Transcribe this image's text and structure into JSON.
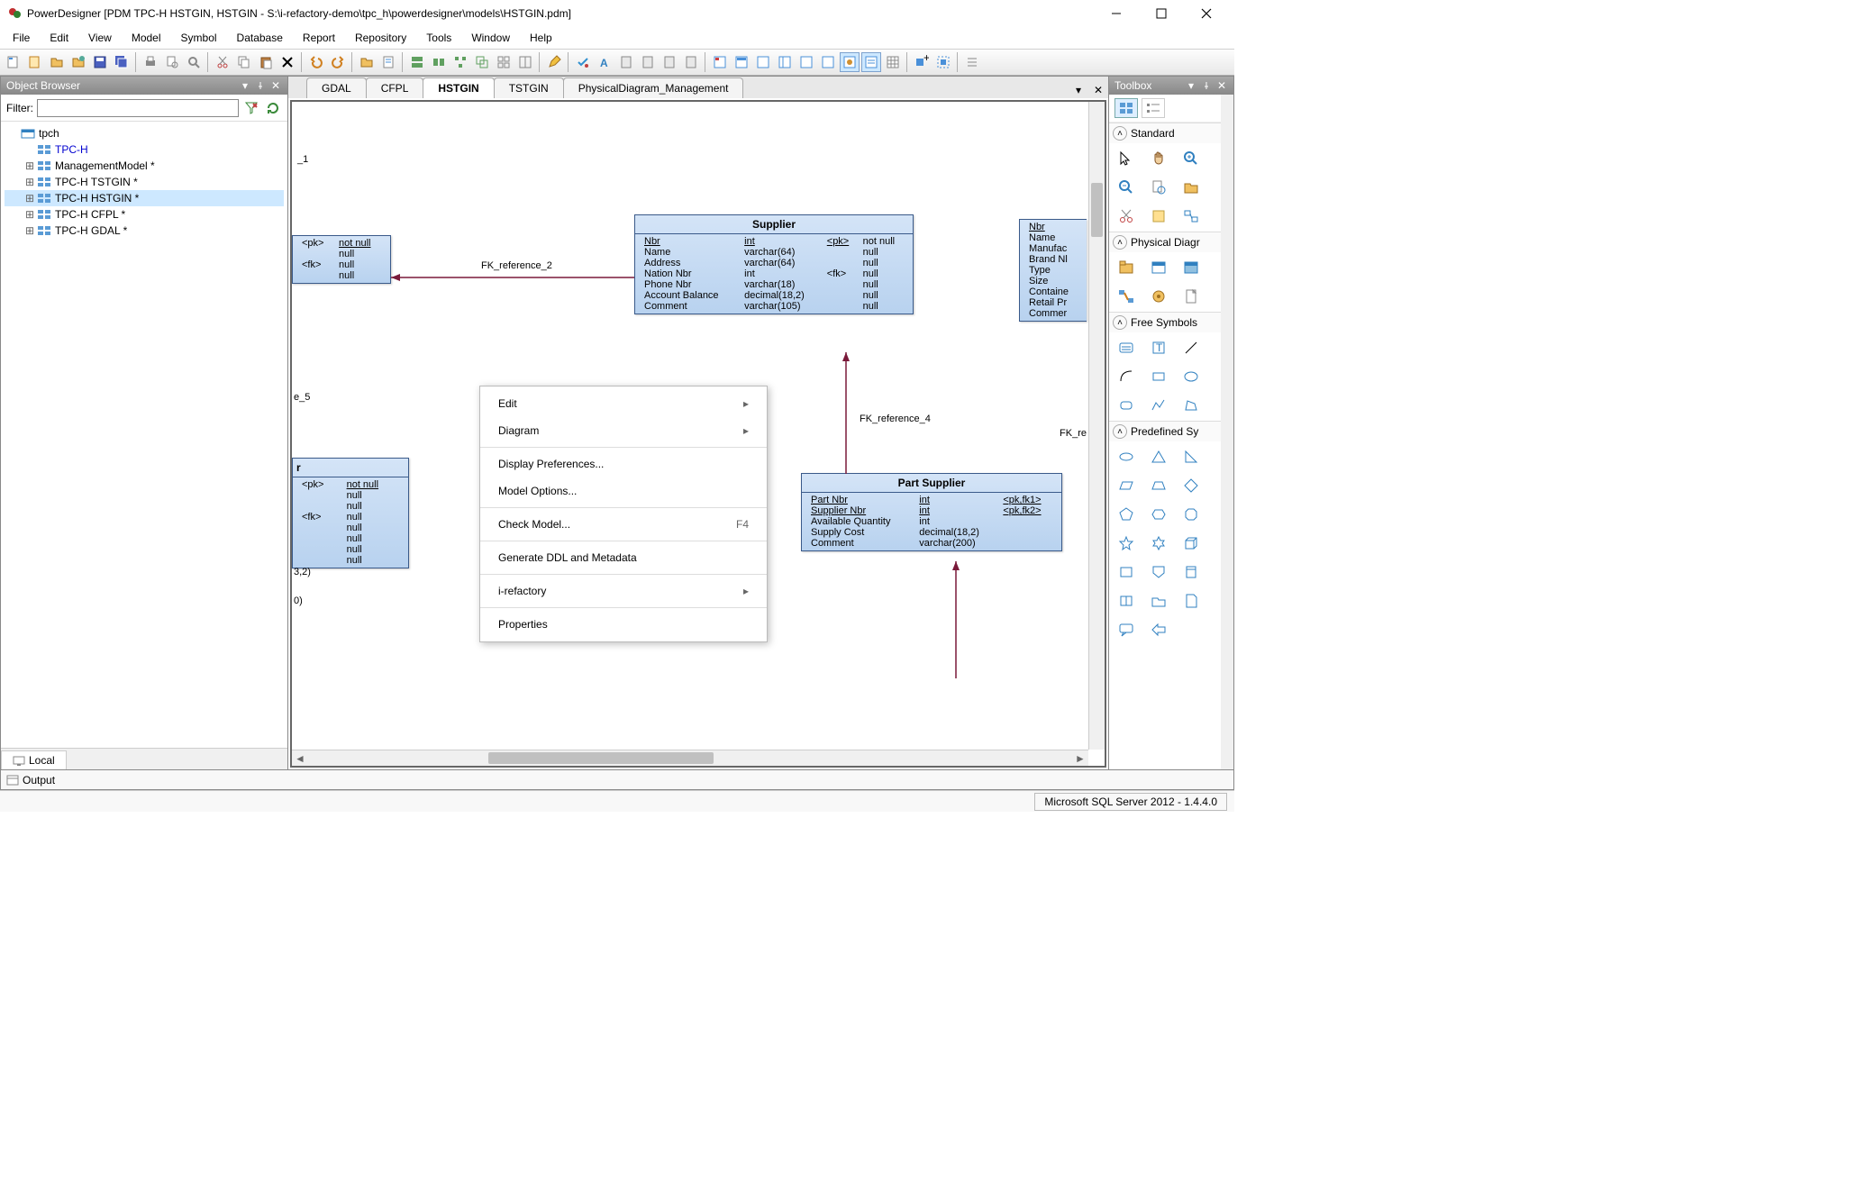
{
  "window": {
    "title": "PowerDesigner [PDM TPC-H HSTGIN, HSTGIN - S:\\i-refactory-demo\\tpc_h\\powerdesigner\\models\\HSTGIN.pdm]"
  },
  "menu": [
    "File",
    "Edit",
    "View",
    "Model",
    "Symbol",
    "Database",
    "Report",
    "Repository",
    "Tools",
    "Window",
    "Help"
  ],
  "object_browser": {
    "title": "Object Browser",
    "filter_label": "Filter:",
    "filter_value": "",
    "tree": [
      {
        "indent": 0,
        "exp": "",
        "icon": "workspace",
        "label": "tpch"
      },
      {
        "indent": 1,
        "exp": "",
        "icon": "model",
        "label": "TPC-H",
        "blue": true
      },
      {
        "indent": 1,
        "exp": "+",
        "icon": "model",
        "label": "ManagementModel *"
      },
      {
        "indent": 1,
        "exp": "+",
        "icon": "model",
        "label": "TPC-H TSTGIN *"
      },
      {
        "indent": 1,
        "exp": "+",
        "icon": "model",
        "label": "TPC-H HSTGIN *",
        "sel": true
      },
      {
        "indent": 1,
        "exp": "+",
        "icon": "model",
        "label": "TPC-H CFPL *"
      },
      {
        "indent": 1,
        "exp": "+",
        "icon": "model",
        "label": "TPC-H GDAL *"
      }
    ],
    "local_tab": "Local",
    "output_tab": "Output"
  },
  "doc_tabs": {
    "tabs": [
      "GDAL",
      "CFPL",
      "HSTGIN",
      "TSTGIN",
      "PhysicalDiagram_Management"
    ],
    "active": "HSTGIN"
  },
  "canvas_text": {
    "frag1": "_1",
    "frag5": "e_5",
    "fragR": "r",
    "fragB": "3,2)",
    "fragC": "0)",
    "fk2": "FK_reference_2",
    "fk4": "FK_reference_4",
    "fkre": "FK_re"
  },
  "entity_left": {
    "rows": [
      {
        "c1": "<pk>",
        "c2": "not null",
        "u": true
      },
      {
        "c1": "",
        "c2": "null"
      },
      {
        "c1": "<fk>",
        "c2": "null"
      },
      {
        "c1": "",
        "c2": "null"
      }
    ]
  },
  "entity_left2": {
    "rows": [
      {
        "c1": "<pk>",
        "c2": "not null",
        "u": true
      },
      {
        "c1": "",
        "c2": "null"
      },
      {
        "c1": "",
        "c2": "null"
      },
      {
        "c1": "<fk>",
        "c2": "null"
      },
      {
        "c1": "",
        "c2": "null"
      },
      {
        "c1": "",
        "c2": "null"
      },
      {
        "c1": "",
        "c2": "null"
      },
      {
        "c1": "",
        "c2": "null"
      }
    ]
  },
  "supplier": {
    "title": "Supplier",
    "rows": [
      {
        "name": "Nbr",
        "type": "int",
        "key": "<pk>",
        "null": "not null",
        "u": true
      },
      {
        "name": "Name",
        "type": "varchar(64)",
        "key": "",
        "null": "null"
      },
      {
        "name": "Address",
        "type": "varchar(64)",
        "key": "",
        "null": "null"
      },
      {
        "name": "Nation Nbr",
        "type": "int",
        "key": "<fk>",
        "null": "null"
      },
      {
        "name": "Phone Nbr",
        "type": "varchar(18)",
        "key": "",
        "null": "null"
      },
      {
        "name": "Account Balance",
        "type": "decimal(18,2)",
        "key": "",
        "null": "null"
      },
      {
        "name": "Comment",
        "type": "varchar(105)",
        "key": "",
        "null": "null"
      }
    ]
  },
  "part_right": {
    "rows": [
      "Nbr",
      "Name",
      "Manufac",
      "Brand Nl",
      "Type",
      "Size",
      "Containe",
      "Retail Pr",
      "Commer"
    ]
  },
  "part_supplier": {
    "title": "Part Supplier",
    "rows": [
      {
        "name": "Part Nbr",
        "type": "int",
        "key": "<pk,fk1>",
        "u": true
      },
      {
        "name": "Supplier Nbr",
        "type": "int",
        "key": "<pk,fk2>",
        "u": true
      },
      {
        "name": "Available Quantity",
        "type": "int",
        "key": ""
      },
      {
        "name": "Supply Cost",
        "type": "decimal(18,2)",
        "key": ""
      },
      {
        "name": "Comment",
        "type": "varchar(200)",
        "key": ""
      }
    ]
  },
  "context_menu": [
    {
      "label": "Edit",
      "arrow": true
    },
    {
      "label": "Diagram",
      "arrow": true
    },
    {
      "sep": true
    },
    {
      "label": "Display Preferences..."
    },
    {
      "label": "Model Options..."
    },
    {
      "sep": true
    },
    {
      "label": "Check Model...",
      "accel": "F4"
    },
    {
      "sep": true
    },
    {
      "label": "Generate DDL and Metadata"
    },
    {
      "sep": true
    },
    {
      "label": "i-refactory",
      "arrow": true
    },
    {
      "sep": true
    },
    {
      "label": "Properties"
    }
  ],
  "toolbox": {
    "title": "Toolbox",
    "sections": [
      {
        "name": "Standard"
      },
      {
        "name": "Physical Diagr"
      },
      {
        "name": "Free Symbols"
      },
      {
        "name": "Predefined Sy"
      }
    ]
  },
  "status": {
    "text": "Microsoft SQL Server 2012 - 1.4.4.0"
  }
}
